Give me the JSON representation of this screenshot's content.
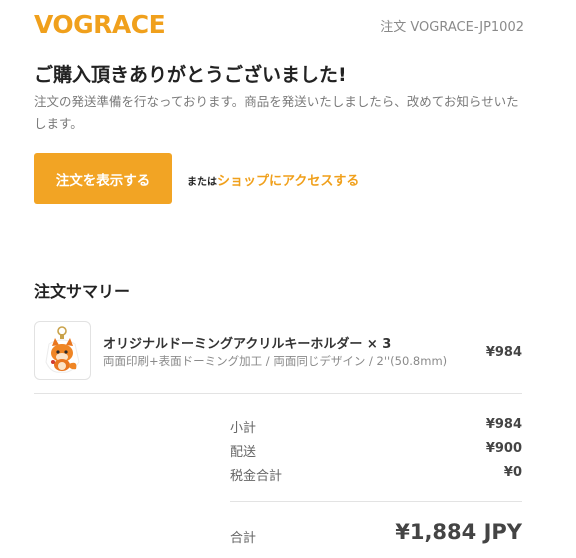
{
  "header": {
    "logo": "VOGRACE",
    "order_number": "注文 VOGRACE-JP1002"
  },
  "message": {
    "title": "ご購入頂きありがとうございました!",
    "body": "注文の発送準備を行なっております。商品を発送いたしましたら、改めてお知らせいたします。"
  },
  "actions": {
    "view_order_label": "注文を表示する",
    "or_text": "または",
    "shop_link": "ショップにアクセスする"
  },
  "summary": {
    "title": "注文サマリー",
    "item": {
      "name": "オリジナルドーミングアクリルキーホルダー × 3",
      "variant": "両面印刷+表面ドーミング加工 / 両面同じデザイン / 2''(50.8mm)",
      "price": "¥984"
    },
    "subtotal_label": "小計",
    "subtotal_value": "¥984",
    "shipping_label": "配送",
    "shipping_value": "¥900",
    "tax_label": "税金合計",
    "tax_value": "¥0",
    "total_label": "合計",
    "total_value": "¥1,884 JPY"
  },
  "colors": {
    "brand": "#f0a01c",
    "button": "#f2a424"
  }
}
